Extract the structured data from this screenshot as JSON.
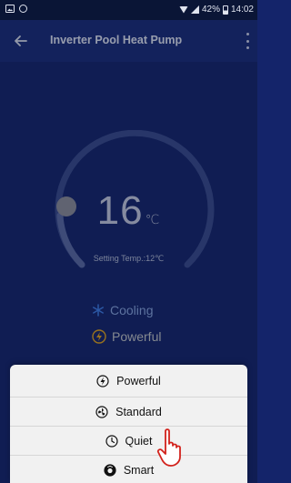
{
  "statusbar": {
    "battery": "42%",
    "time": "14:02",
    "icons": [
      "image-icon",
      "sync-icon",
      "wifi-icon",
      "signal-icon",
      "battery-icon"
    ]
  },
  "header": {
    "title": "Inverter Pool Heat Pump",
    "back_icon": "arrow-left-icon",
    "menu_icon": "more-vertical-icon"
  },
  "thermostat": {
    "current_temp": "16",
    "unit": "℃",
    "setting_label": "Setting Temp.:12℃"
  },
  "modes": [
    {
      "label": "Cooling",
      "icon": "snowflake-icon",
      "color": "#3f7ee8"
    },
    {
      "label": "Powerful",
      "icon": "lightning-icon",
      "color": "#e7a71a"
    }
  ],
  "sheet": {
    "items": [
      {
        "label": "Powerful",
        "icon": "lightning-circle-icon"
      },
      {
        "label": "Standard",
        "icon": "fan-icon"
      },
      {
        "label": "Quiet",
        "icon": "clock-icon"
      },
      {
        "label": "Smart",
        "icon": "smart-icon"
      }
    ]
  },
  "colors": {
    "background": "#14246a",
    "accent_blue": "#3f7ee8",
    "accent_yellow": "#e7a71a",
    "sheet_bg": "#f1f1f1"
  }
}
